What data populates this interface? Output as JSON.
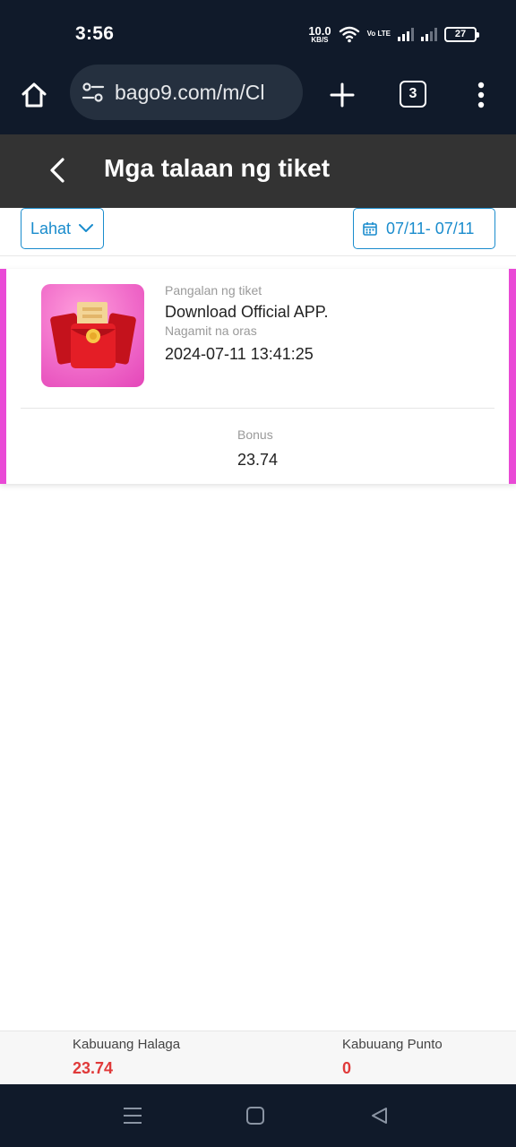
{
  "status_bar": {
    "time": "3:56",
    "net_speed_value": "10.0",
    "net_speed_unit": "KB/S",
    "volte": "Vo LTE",
    "battery": "27"
  },
  "browser": {
    "url": "bago9.com/m/Cl",
    "tab_count": "3"
  },
  "header": {
    "title": "Mga talaan ng tiket"
  },
  "filters": {
    "type_label": "Lahat",
    "date_range": "07/11- 07/11"
  },
  "ticket": {
    "name_label": "Pangalan ng tiket",
    "name": "Download Official APP.",
    "time_label": "Nagamit na oras",
    "time": "2024-07-11 13:41:25",
    "bonus_label": "Bonus",
    "bonus": "23.74"
  },
  "totals": {
    "amount_label": "Kabuuang Halaga",
    "amount_value": "23.74",
    "points_label": "Kabuuang Punto",
    "points_value": "0"
  },
  "colors": {
    "accent_blue": "#1a8ccd",
    "ticket_border_pink": "#e94ad6",
    "total_red": "#e03a3a",
    "header_bg": "#333333",
    "system_bg": "#101a2a"
  }
}
